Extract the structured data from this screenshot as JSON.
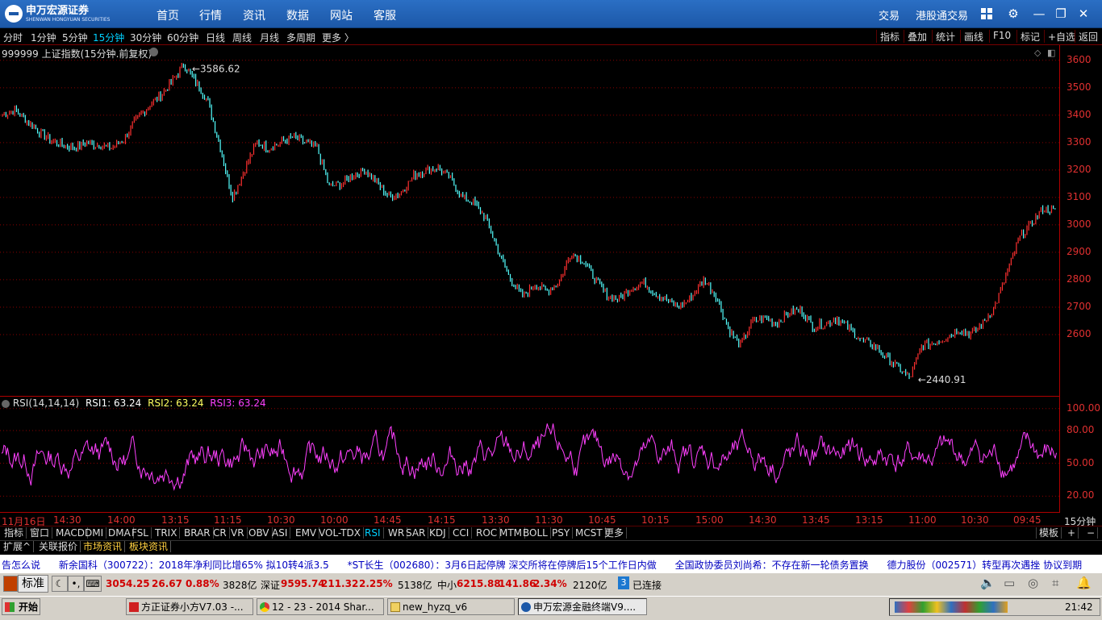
{
  "app": {
    "brand": "申万宏源证券",
    "brand_sub": "SHENWAN HONGYUAN SECURITIES",
    "nav": [
      "首页",
      "行情",
      "资讯",
      "数据",
      "网站",
      "客服"
    ],
    "right_links": [
      "交易",
      "港股通交易"
    ]
  },
  "toolbar": {
    "periods": [
      "分时",
      "1分钟",
      "5分钟",
      "15分钟",
      "30分钟",
      "60分钟",
      "日线",
      "周线",
      "月线",
      "多周期",
      "更多 〉"
    ],
    "selected_period": "15分钟",
    "right_buttons": [
      "指标",
      "叠加",
      "统计",
      "画线",
      "F10",
      "标记",
      "+自选",
      "返回"
    ]
  },
  "chart_title": "999999 上证指数(15分钟.前复权)",
  "rsi_legend": {
    "name": "RSI(14,14,14)",
    "rsi1_label": "RSI1: 63.24",
    "rsi2_label": "RSI2: 63.24",
    "rsi3_label": "RSI3: 63.24"
  },
  "period_label": "15分钟",
  "colors": {
    "up": "#ff3030",
    "down": "#54ffff",
    "rsi": "#ff40ff",
    "axis": "#e03030",
    "grid": "#8b0000"
  },
  "chart_data": [
    {
      "type": "candlestick",
      "title": "999999 上证指数(15分钟.前复权)",
      "ylim": [
        2400,
        3620
      ],
      "yticks": [
        3600,
        3500,
        3400,
        3300,
        3200,
        3100,
        3000,
        2900,
        2800,
        2700,
        2600
      ],
      "annotations": [
        {
          "label": "3586.62",
          "value": 3586.62
        },
        {
          "label": "2440.91",
          "value": 2440.91
        }
      ],
      "x_tick_labels": [
        "11月16日",
        "14:30",
        "14:00",
        "13:15",
        "11:15",
        "10:30",
        "10:00",
        "14:45",
        "14:15",
        "13:30",
        "11:30",
        "10:45",
        "10:15",
        "15:00",
        "14:30",
        "13:45",
        "13:15",
        "11:00",
        "10:30",
        "09:45"
      ],
      "series": [
        {
          "values": [
            3400,
            3420,
            3380,
            3340,
            3310,
            3290,
            3280,
            3300,
            3290,
            3280,
            3310,
            3380,
            3430,
            3470,
            3520,
            3586.62,
            3520,
            3450,
            3280,
            3100,
            3200,
            3300,
            3280,
            3300,
            3320,
            3300,
            3280,
            3140,
            3150,
            3180,
            3200,
            3150,
            3100,
            3120,
            3180,
            3200,
            3210,
            3170,
            3100,
            3080,
            3020,
            2900,
            2800,
            2740,
            2780,
            2760,
            2790,
            2900,
            2870,
            2800,
            2740,
            2730,
            2770,
            2790,
            2750,
            2720,
            2700,
            2740,
            2800,
            2740,
            2620,
            2560,
            2650,
            2660,
            2640,
            2680,
            2690,
            2630,
            2640,
            2660,
            2620,
            2580,
            2560,
            2520,
            2480,
            2440.91,
            2560,
            2570,
            2590,
            2620,
            2600,
            2640,
            2700,
            2820,
            2950,
            3000,
            3060,
            3050
          ]
        }
      ]
    },
    {
      "type": "line",
      "title": "RSI(14,14,14)",
      "ylim": [
        10,
        105
      ],
      "yticks": [
        100.0,
        80.0,
        50.0,
        20.0
      ],
      "series": [
        {
          "name": "RSI1",
          "last": 63.24
        },
        {
          "name": "RSI2",
          "last": 63.24
        },
        {
          "name": "RSI3",
          "last": 63.24
        }
      ]
    }
  ],
  "indicator_tabs": [
    "指标",
    "窗口",
    "MACD",
    "DMI",
    "DMA",
    "FSL",
    "TRIX",
    "BRAR",
    "CR",
    "VR",
    "OBV",
    "ASI",
    "EMV",
    "VOL-TDX",
    "RSI",
    "WR",
    "SAR",
    "KDJ",
    "CCI",
    "ROC",
    "MTM",
    "BOLL",
    "PSY",
    "MCST",
    "更多"
  ],
  "selected_indicator": "RSI",
  "indicator_right": [
    "模板",
    "+",
    "−"
  ],
  "sub_tabs": [
    "扩展^",
    "关联报价",
    "市场资讯",
    "板块资讯"
  ],
  "ticker": "告怎么说      新余国科（300722）：2018年净利同比增65% 拟10转4派3.5      *ST长生（002680）：3月6日起停牌 深交所将在停牌后15个工作日内做      全国政协委员刘尚希：不存在新一轮债务置换      德力股份（002571）转型再次遇挫 协议到期",
  "status": {
    "mode": "标准",
    "sh": {
      "value": "3054.25",
      "chg": "26.67",
      "pct": "0.88%",
      "amount": "3828亿"
    },
    "sz": {
      "label": "深证",
      "value": "9595.74",
      "chg": "211.32",
      "pct": "2.25%",
      "amount": "5138亿"
    },
    "zx": {
      "label": "中小",
      "value": "6215.88",
      "chg": "141.86",
      "pct": "2.34%",
      "amount": "2120亿"
    },
    "conn_num": "3",
    "conn": "已连接"
  },
  "taskbar": {
    "start": "开始",
    "tasks": [
      "方正证券小方V7.03 -...",
      "12 - 23 - 2014 Shar...",
      "new_hyzq_v6",
      "申万宏源金融终端V9...."
    ],
    "clock": "21:42"
  }
}
